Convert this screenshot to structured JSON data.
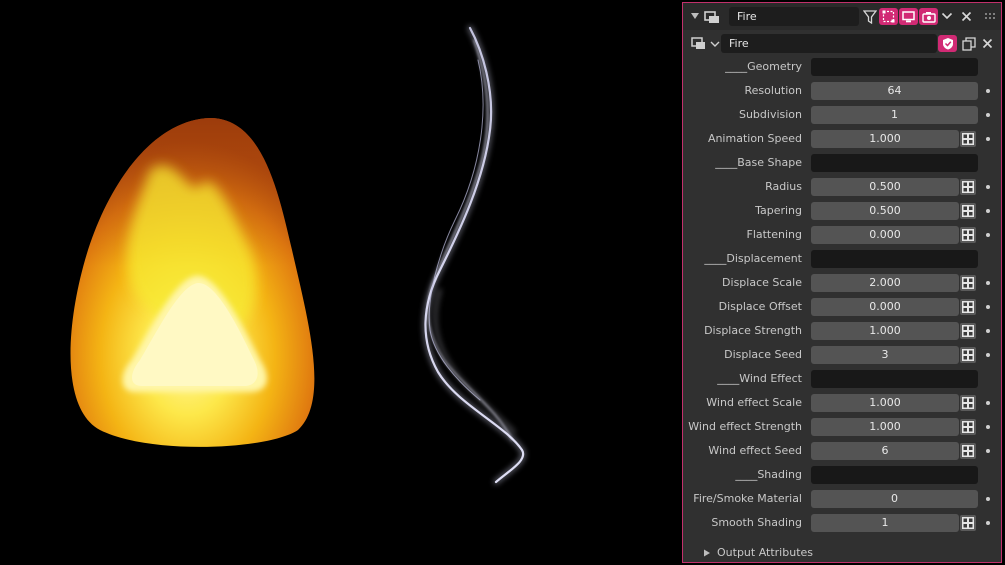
{
  "header": {
    "name": "Fire",
    "icons": [
      "collapse-triangle-icon",
      "object-data-icon",
      "filter-icon",
      "select-icon",
      "viewport-icon",
      "render-camera-icon",
      "chevron-down-icon",
      "close-icon",
      "drag-handle-icon"
    ]
  },
  "modifier": {
    "name": "Fire",
    "icons": [
      "geometry-nodes-icon",
      "chevron-down-icon",
      "fake-user-shield-icon",
      "duplicate-icon",
      "close-icon"
    ]
  },
  "rows": [
    {
      "label": "____Geometry",
      "value": "",
      "kind": "dark",
      "node": false,
      "dot": false
    },
    {
      "label": "Resolution",
      "value": "64",
      "kind": "full",
      "node": false,
      "dot": true
    },
    {
      "label": "Subdivision",
      "value": "1",
      "kind": "full",
      "node": false,
      "dot": true
    },
    {
      "label": "Animation Speed",
      "value": "1.000",
      "kind": "short",
      "node": true,
      "dot": true
    },
    {
      "label": "____Base Shape",
      "value": "",
      "kind": "dark",
      "node": false,
      "dot": false
    },
    {
      "label": "Radius",
      "value": "0.500",
      "kind": "short",
      "node": true,
      "dot": true
    },
    {
      "label": "Tapering",
      "value": "0.500",
      "kind": "short",
      "node": true,
      "dot": true
    },
    {
      "label": "Flattening",
      "value": "0.000",
      "kind": "short",
      "node": true,
      "dot": true
    },
    {
      "label": "____Displacement",
      "value": "",
      "kind": "dark",
      "node": false,
      "dot": false
    },
    {
      "label": "Displace Scale",
      "value": "2.000",
      "kind": "short",
      "node": true,
      "dot": true
    },
    {
      "label": "Displace Offset",
      "value": "0.000",
      "kind": "short",
      "node": true,
      "dot": true
    },
    {
      "label": "Displace Strength",
      "value": "1.000",
      "kind": "short",
      "node": true,
      "dot": true
    },
    {
      "label": "Displace Seed",
      "value": "3",
      "kind": "short",
      "node": true,
      "dot": true
    },
    {
      "label": "____Wind Effect",
      "value": "",
      "kind": "dark",
      "node": false,
      "dot": false
    },
    {
      "label": "Wind effect Scale",
      "value": "1.000",
      "kind": "short",
      "node": true,
      "dot": true
    },
    {
      "label": "Wind effect Strength",
      "value": "1.000",
      "kind": "short",
      "node": true,
      "dot": true
    },
    {
      "label": "Wind effect Seed",
      "value": "6",
      "kind": "short",
      "node": true,
      "dot": true
    },
    {
      "label": "____Shading",
      "value": "",
      "kind": "dark",
      "node": false,
      "dot": false
    },
    {
      "label": "Fire/Smoke Material",
      "value": "0",
      "kind": "full",
      "node": false,
      "dot": true
    },
    {
      "label": "Smooth Shading",
      "value": "1",
      "kind": "short",
      "node": true,
      "dot": true
    }
  ],
  "footer": {
    "label": "Output Attributes",
    "icon": "expand-triangle-icon"
  },
  "colors": {
    "accent": "#d12a74",
    "panel_bg": "#303030",
    "field_bg": "#545454",
    "outline": "#c2306b"
  }
}
